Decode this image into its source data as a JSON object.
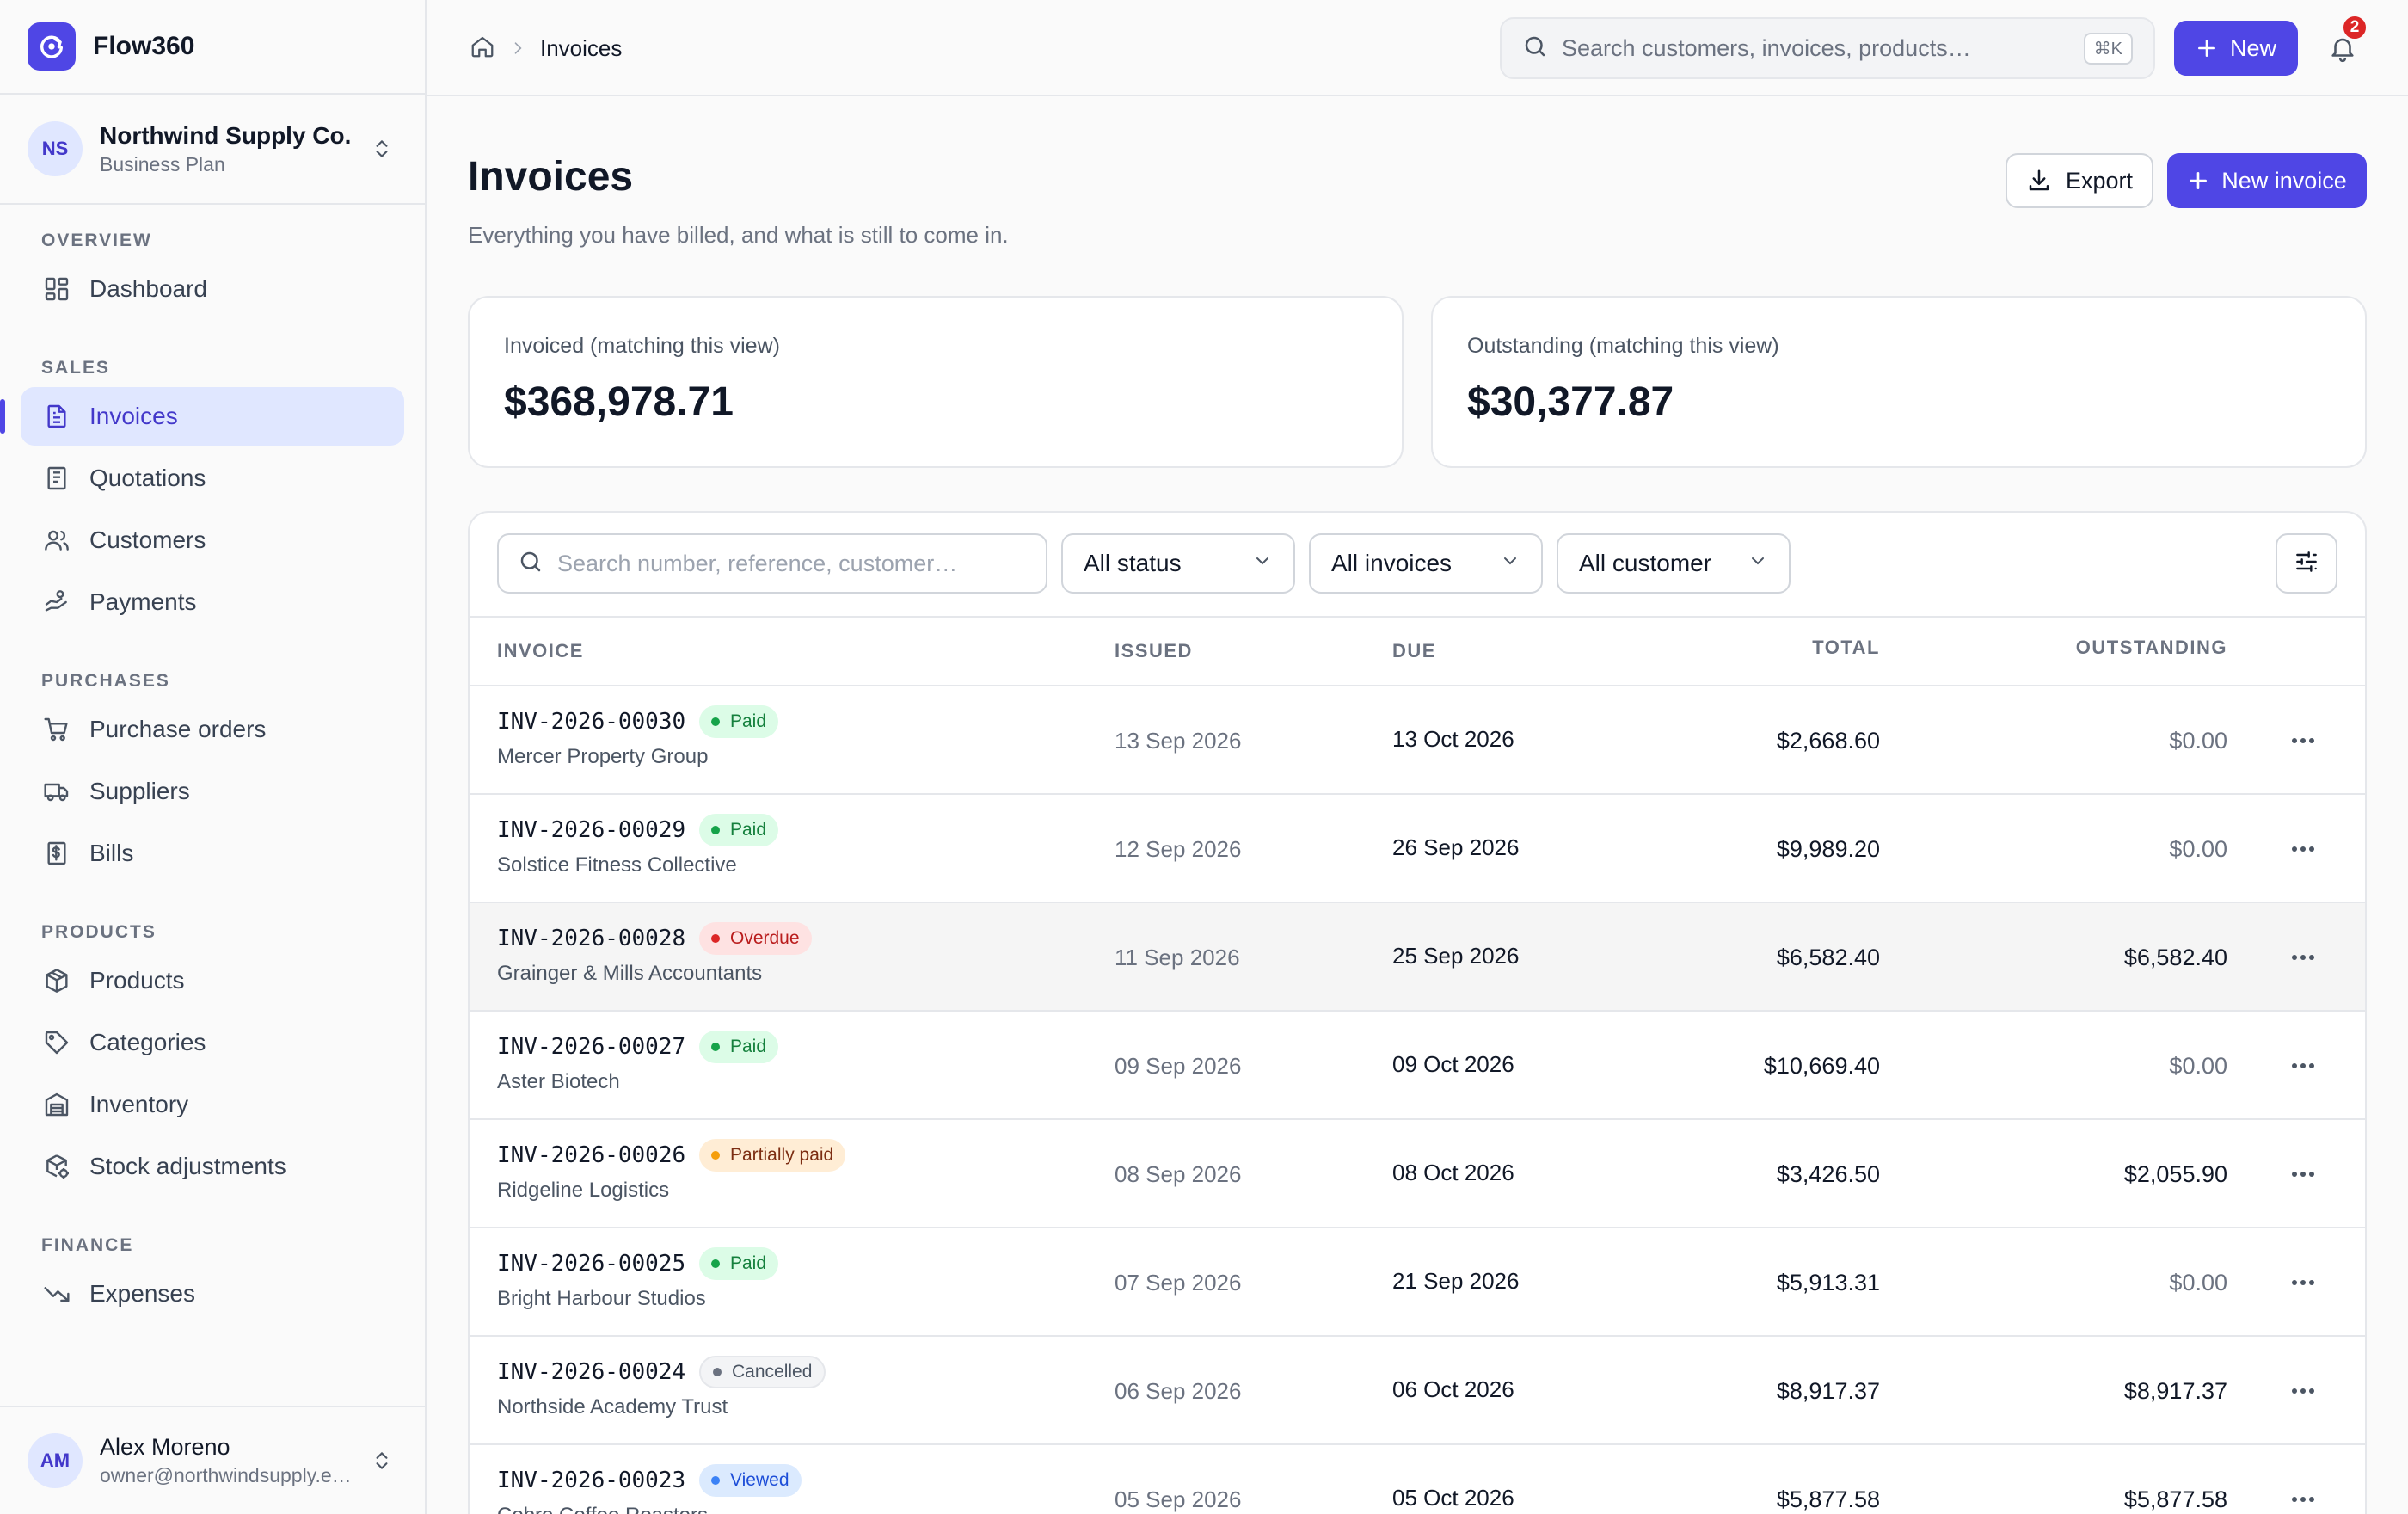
{
  "app": {
    "name": "Flow360"
  },
  "org": {
    "initials": "NS",
    "name": "Northwind Supply Co.",
    "plan": "Business Plan"
  },
  "nav": {
    "sections": [
      {
        "title": "OVERVIEW",
        "items": [
          {
            "label": "Dashboard",
            "icon": "dashboard-icon"
          }
        ]
      },
      {
        "title": "SALES",
        "items": [
          {
            "label": "Invoices",
            "icon": "invoice-icon",
            "active": true
          },
          {
            "label": "Quotations",
            "icon": "quotation-icon"
          },
          {
            "label": "Customers",
            "icon": "users-icon"
          },
          {
            "label": "Payments",
            "icon": "payment-icon"
          }
        ]
      },
      {
        "title": "PURCHASES",
        "items": [
          {
            "label": "Purchase orders",
            "icon": "cart-icon"
          },
          {
            "label": "Suppliers",
            "icon": "truck-icon"
          },
          {
            "label": "Bills",
            "icon": "bill-icon"
          }
        ]
      },
      {
        "title": "PRODUCTS",
        "items": [
          {
            "label": "Products",
            "icon": "box-icon"
          },
          {
            "label": "Categories",
            "icon": "tag-icon"
          },
          {
            "label": "Inventory",
            "icon": "warehouse-icon"
          },
          {
            "label": "Stock adjustments",
            "icon": "stock-adjust-icon"
          }
        ]
      },
      {
        "title": "FINANCE",
        "items": [
          {
            "label": "Expenses",
            "icon": "trend-down-icon"
          }
        ]
      }
    ]
  },
  "user": {
    "initials": "AM",
    "name": "Alex Moreno",
    "email": "owner@northwindsupply.e…"
  },
  "topbar": {
    "breadcrumb_current": "Invoices",
    "search_placeholder": "Search customers, invoices, products…",
    "shortcut": "⌘K",
    "new_label": "New",
    "notification_count": "2"
  },
  "page": {
    "title": "Invoices",
    "subtitle": "Everything you have billed, and what is still to come in.",
    "export_label": "Export",
    "new_invoice_label": "New invoice"
  },
  "summary": {
    "invoiced_label": "Invoiced (matching this view)",
    "invoiced_value": "$368,978.71",
    "outstanding_label": "Outstanding (matching this view)",
    "outstanding_value": "$30,377.87"
  },
  "filters": {
    "search_placeholder": "Search number, reference, customer…",
    "status": "All status",
    "invoices": "All invoices",
    "customer": "All customer"
  },
  "table": {
    "headers": {
      "invoice": "INVOICE",
      "issued": "ISSUED",
      "due": "DUE",
      "total": "TOTAL",
      "outstanding": "OUTSTANDING"
    },
    "rows": [
      {
        "number": "INV-2026-00030",
        "status": "Paid",
        "status_kind": "paid",
        "customer": "Mercer Property Group",
        "issued": "13 Sep 2026",
        "due": "13 Oct 2026",
        "total": "$2,668.60",
        "outstanding": "$0.00"
      },
      {
        "number": "INV-2026-00029",
        "status": "Paid",
        "status_kind": "paid",
        "customer": "Solstice Fitness Collective",
        "issued": "12 Sep 2026",
        "due": "26 Sep 2026",
        "total": "$9,989.20",
        "outstanding": "$0.00"
      },
      {
        "number": "INV-2026-00028",
        "status": "Overdue",
        "status_kind": "overdue",
        "customer": "Grainger & Mills Accountants",
        "issued": "11 Sep 2026",
        "due": "25 Sep 2026",
        "total": "$6,582.40",
        "outstanding": "$6,582.40"
      },
      {
        "number": "INV-2026-00027",
        "status": "Paid",
        "status_kind": "paid",
        "customer": "Aster Biotech",
        "issued": "09 Sep 2026",
        "due": "09 Oct 2026",
        "total": "$10,669.40",
        "outstanding": "$0.00"
      },
      {
        "number": "INV-2026-00026",
        "status": "Partially paid",
        "status_kind": "partial",
        "customer": "Ridgeline Logistics",
        "issued": "08 Sep 2026",
        "due": "08 Oct 2026",
        "total": "$3,426.50",
        "outstanding": "$2,055.90"
      },
      {
        "number": "INV-2026-00025",
        "status": "Paid",
        "status_kind": "paid",
        "customer": "Bright Harbour Studios",
        "issued": "07 Sep 2026",
        "due": "21 Sep 2026",
        "total": "$5,913.31",
        "outstanding": "$0.00"
      },
      {
        "number": "INV-2026-00024",
        "status": "Cancelled",
        "status_kind": "cancelled",
        "customer": "Northside Academy Trust",
        "issued": "06 Sep 2026",
        "due": "06 Oct 2026",
        "total": "$8,917.37",
        "outstanding": "$8,917.37"
      },
      {
        "number": "INV-2026-00023",
        "status": "Viewed",
        "status_kind": "viewed",
        "customer": "Cobre Coffee Roasters",
        "issued": "05 Sep 2026",
        "due": "05 Oct 2026",
        "total": "$5,877.58",
        "outstanding": "$5,877.58"
      }
    ]
  },
  "colors": {
    "accent": "#4f46e5",
    "active_bg": "#e0e7ff",
    "paid": "#16a34a",
    "overdue": "#dc2626",
    "partial": "#f59e0b",
    "viewed": "#3b82f6"
  }
}
